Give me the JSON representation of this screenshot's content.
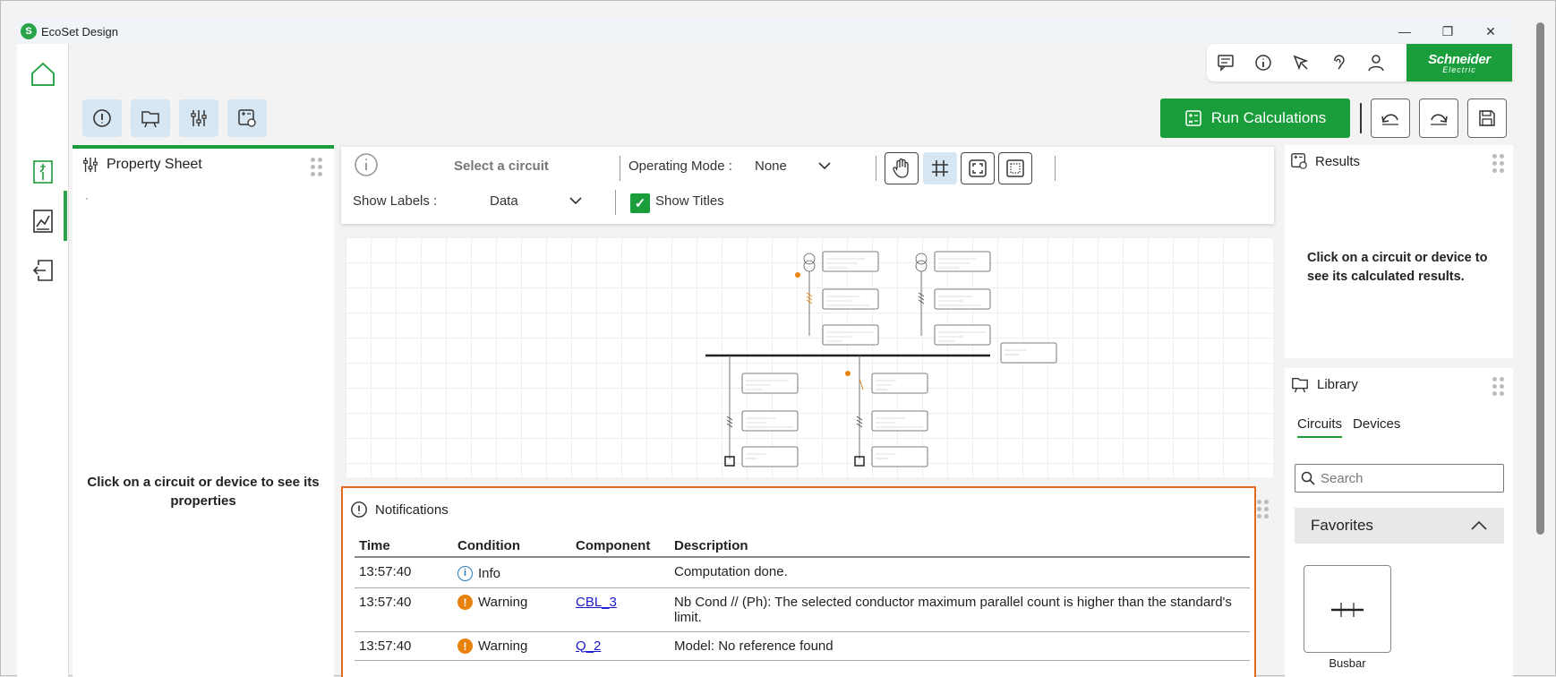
{
  "app": {
    "title": "EcoSet Design",
    "logo_letter": "S"
  },
  "window_controls": {
    "minimize": "—",
    "restore": "❐",
    "close": "✕"
  },
  "brand": {
    "line1": "Schneider",
    "line2": "Electric"
  },
  "toolbar": {
    "run_label": "Run Calculations"
  },
  "property_sheet": {
    "title": "Property Sheet",
    "dot": "·",
    "hint": "Click on a circuit or device to see its properties"
  },
  "controls": {
    "select_circuit": "Select a circuit",
    "operating_mode_label": "Operating Mode :",
    "operating_mode_value": "None",
    "show_labels_label": "Show Labels :",
    "show_labels_value": "Data",
    "show_titles_label": "Show Titles"
  },
  "notifications": {
    "title": "Notifications",
    "columns": [
      "Time",
      "Condition",
      "Component",
      "Description"
    ],
    "rows": [
      {
        "time": "13:57:40",
        "condition": "Info",
        "component": "",
        "description": "Computation done."
      },
      {
        "time": "13:57:40",
        "condition": "Warning",
        "component": "CBL_3",
        "description": "Nb Cond // (Ph): The selected conductor maximum parallel count is higher than the standard's limit."
      },
      {
        "time": "13:57:40",
        "condition": "Warning",
        "component": "Q_2",
        "description": "Model: No reference found"
      }
    ]
  },
  "results": {
    "title": "Results",
    "hint": "Click on a circuit or device to see its calculated results."
  },
  "library": {
    "title": "Library",
    "tabs": [
      "Circuits",
      "Devices"
    ],
    "search_placeholder": "Search",
    "favorites_label": "Favorites",
    "busbar_label": "Busbar"
  },
  "colors": {
    "accent": "#1a9e3b",
    "notif_border": "#e06a22",
    "warning": "#e8820c",
    "info": "#2a7ab8"
  }
}
